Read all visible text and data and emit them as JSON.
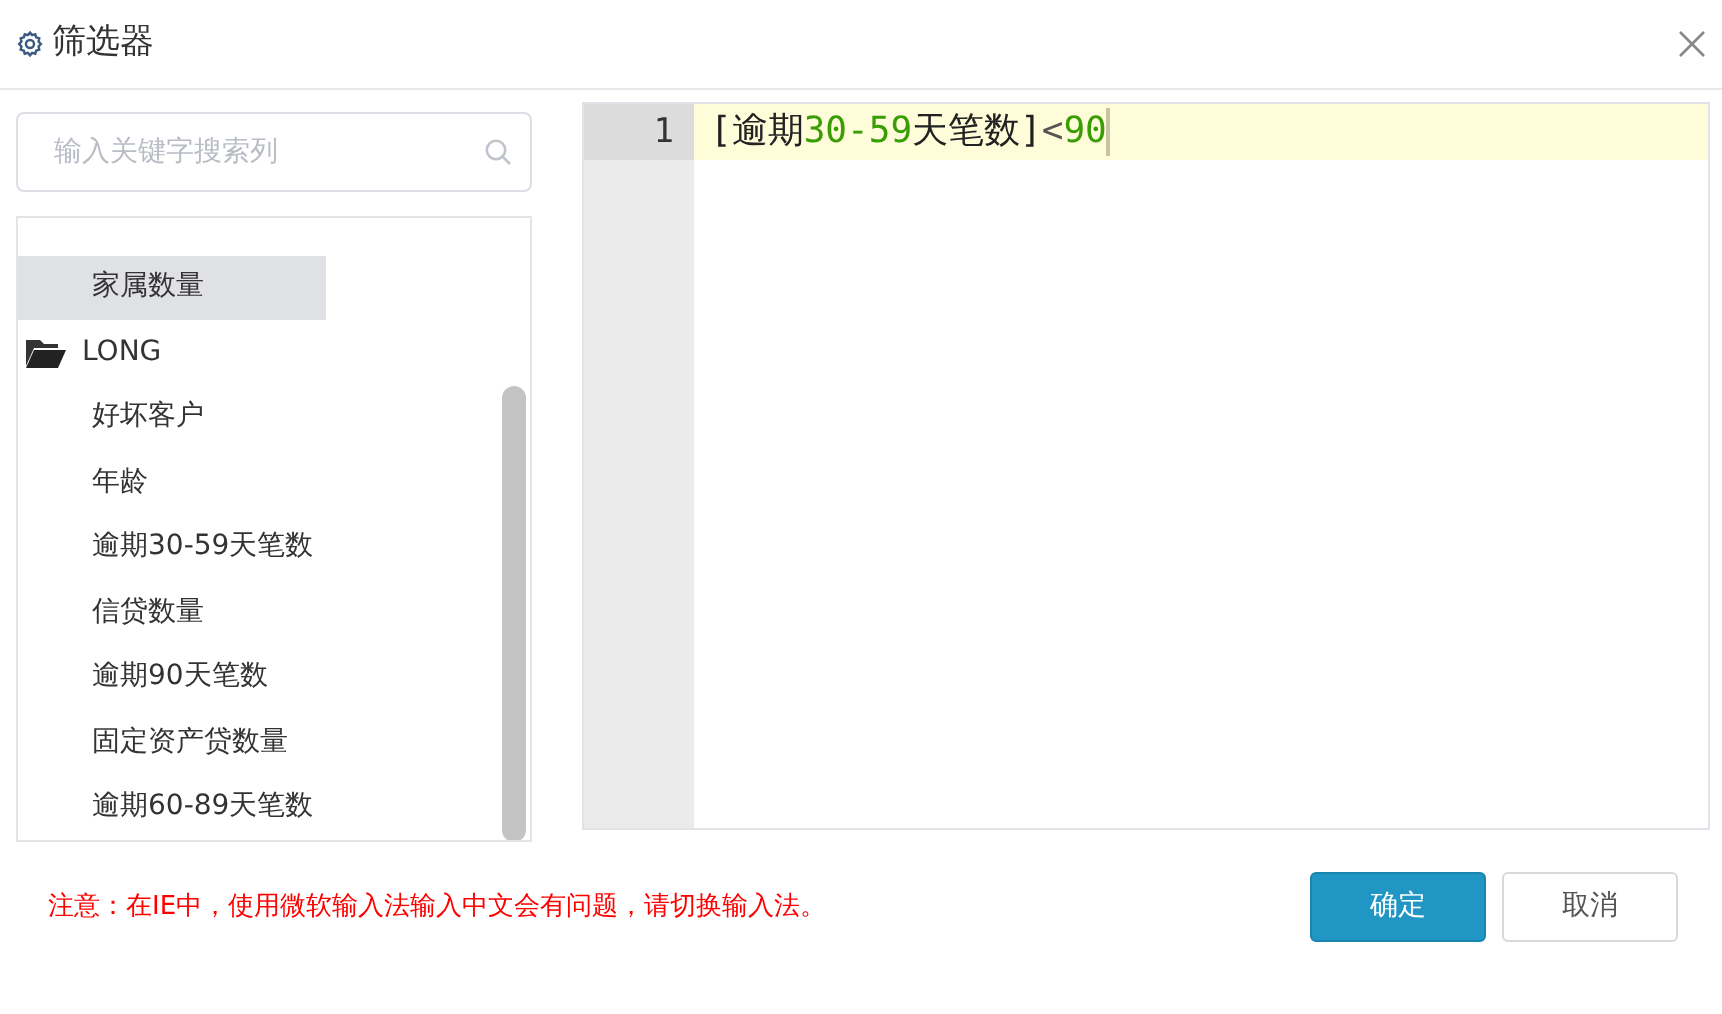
{
  "window": {
    "title": "筛选器"
  },
  "search": {
    "placeholder": "输入关键字搜索列"
  },
  "columns": [
    {
      "kind": "field",
      "label": "家属数量",
      "selected": true
    },
    {
      "kind": "folder",
      "label": "LONG",
      "selected": false
    },
    {
      "kind": "field",
      "label": "好坏客户",
      "selected": false
    },
    {
      "kind": "field",
      "label": "年龄",
      "selected": false
    },
    {
      "kind": "field",
      "label": "逾期30-59天笔数",
      "selected": false
    },
    {
      "kind": "field",
      "label": "信贷数量",
      "selected": false
    },
    {
      "kind": "field",
      "label": "逾期90天笔数",
      "selected": false
    },
    {
      "kind": "field",
      "label": "固定资产贷数量",
      "selected": false
    },
    {
      "kind": "field",
      "label": "逾期60-89天笔数",
      "selected": false
    }
  ],
  "editor": {
    "lines": [
      {
        "number": "1",
        "tokens": [
          {
            "kind": "bracket",
            "text": "["
          },
          {
            "kind": "text",
            "text": "逾期"
          },
          {
            "kind": "number",
            "text": "30-59"
          },
          {
            "kind": "text",
            "text": "天笔数"
          },
          {
            "kind": "bracket",
            "text": "]"
          },
          {
            "kind": "operator",
            "text": "<"
          },
          {
            "kind": "number",
            "text": "90"
          }
        ]
      }
    ]
  },
  "notice": "注意：在IE中，使用微软输入法输入中文会有问题，请切换输入法。",
  "buttons": [
    {
      "kind": "primary",
      "label": "确定"
    },
    {
      "kind": "secondary",
      "label": "取消"
    }
  ]
}
